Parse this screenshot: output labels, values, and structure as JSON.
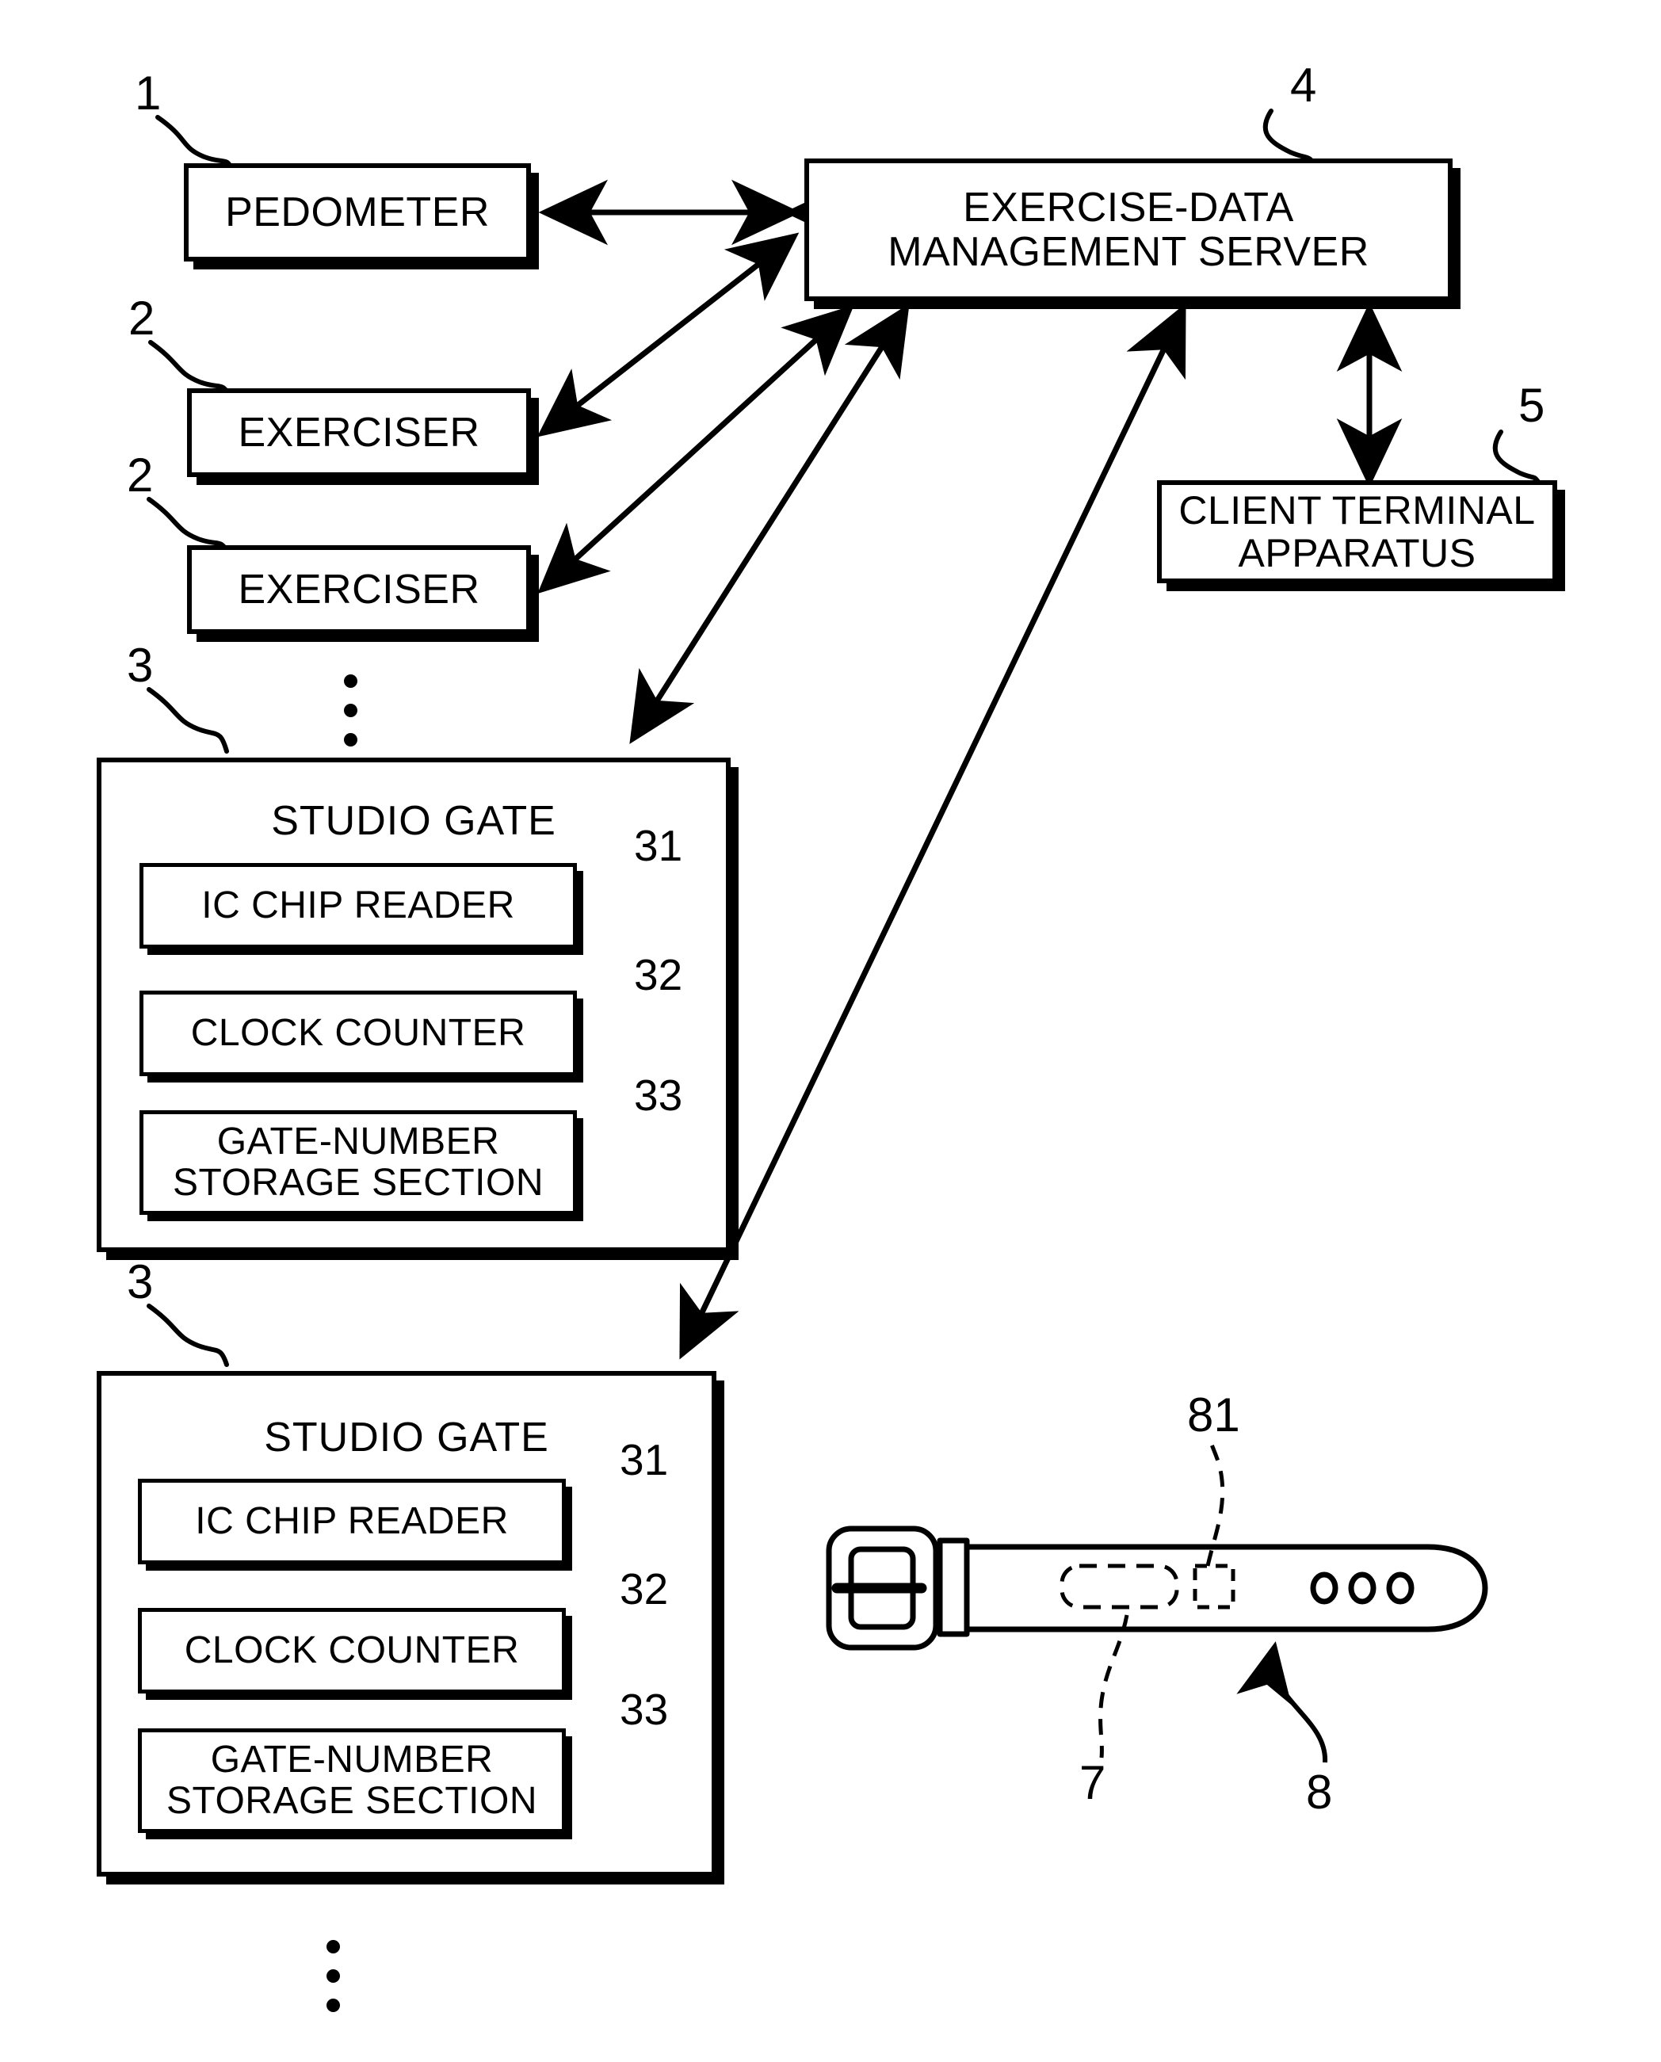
{
  "figure": {
    "type": "patent-block-diagram",
    "background": "#ffffff",
    "line_color": "#000000"
  },
  "blocks": {
    "pedometer": {
      "label": "PEDOMETER",
      "ref": "1"
    },
    "exerciser_1": {
      "label": "EXERCISER",
      "ref": "2"
    },
    "exerciser_2": {
      "label": "EXERCISER",
      "ref": "2"
    },
    "server": {
      "label": "EXERCISE-DATA\nMANAGEMENT SERVER",
      "ref": "4"
    },
    "client_terminal": {
      "label": "CLIENT TERMINAL\nAPPARATUS",
      "ref": "5"
    }
  },
  "studio_gate_1": {
    "title": "STUDIO GATE",
    "ref": "3",
    "components": [
      {
        "label": "IC CHIP READER",
        "ref": "31"
      },
      {
        "label": "CLOCK COUNTER",
        "ref": "32"
      },
      {
        "label": "GATE-NUMBER\nSTORAGE SECTION",
        "ref": "33"
      }
    ]
  },
  "studio_gate_2": {
    "title": "STUDIO GATE",
    "ref": "3",
    "components": [
      {
        "label": "IC CHIP READER",
        "ref": "31"
      },
      {
        "label": "CLOCK COUNTER",
        "ref": "32"
      },
      {
        "label": "GATE-NUMBER\nSTORAGE SECTION",
        "ref": "33"
      }
    ]
  },
  "belt_illustration": {
    "refs": {
      "ic_chip": "7",
      "belt": "8",
      "antenna": "81"
    }
  },
  "ellipses": {
    "upper": "vertical-ellipsis-exercisers",
    "lower": "vertical-ellipsis-studio-gates"
  }
}
